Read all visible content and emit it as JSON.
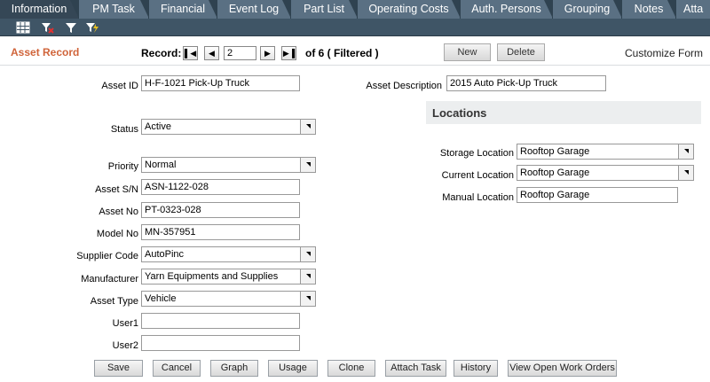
{
  "tabs": [
    {
      "label": "Information",
      "active": true
    },
    {
      "label": "PM Task"
    },
    {
      "label": "Financial"
    },
    {
      "label": "Event Log"
    },
    {
      "label": "Part List"
    },
    {
      "label": "Operating Costs"
    },
    {
      "label": "Auth. Persons"
    },
    {
      "label": "Grouping"
    },
    {
      "label": "Notes"
    },
    {
      "label": "Atta"
    }
  ],
  "toolbar": {
    "icons": [
      "grid-icon",
      "clear-filter-icon",
      "filter-icon",
      "quick-filter-icon"
    ]
  },
  "header": {
    "title": "Asset Record",
    "record_label": "Record:",
    "record_value": "2",
    "of_label": "of 6 ( Filtered )",
    "new_label": "New",
    "delete_label": "Delete",
    "customize_label": "Customize Form"
  },
  "form": {
    "asset_id": {
      "label": "Asset ID",
      "value": "H-F-1021 Pick-Up Truck"
    },
    "asset_description": {
      "label": "Asset Description",
      "value": "2015 Auto Pick-Up Truck"
    },
    "status": {
      "label": "Status",
      "value": "Active"
    },
    "priority": {
      "label": "Priority",
      "value": "Normal"
    },
    "asset_sn": {
      "label": "Asset S/N",
      "value": "ASN-1122-028"
    },
    "asset_no": {
      "label": "Asset No",
      "value": "PT-0323-028"
    },
    "model_no": {
      "label": "Model No",
      "value": "MN-357951"
    },
    "supplier_code": {
      "label": "Supplier Code",
      "value": "AutoPinc"
    },
    "manufacturer": {
      "label": "Manufacturer",
      "value": "Yarn Equipments and Supplies"
    },
    "asset_type": {
      "label": "Asset Type",
      "value": "Vehicle"
    },
    "user1": {
      "label": "User1",
      "value": ""
    },
    "user2": {
      "label": "User2",
      "value": ""
    }
  },
  "locations": {
    "title": "Locations",
    "storage": {
      "label": "Storage Location",
      "value": "Rooftop Garage"
    },
    "current": {
      "label": "Current Location",
      "value": "Rooftop Garage"
    },
    "manual": {
      "label": "Manual Location",
      "value": "Rooftop Garage"
    }
  },
  "buttons": {
    "save": "Save",
    "cancel": "Cancel",
    "graph": "Graph",
    "usage": "Usage",
    "clone": "Clone",
    "attach_task": "Attach Task",
    "history": "History",
    "view_open_work_orders": "View Open Work Orders"
  },
  "colors": {
    "tab_bar": "#53697a",
    "tab_active": "#354756",
    "accent_title": "#d0643a"
  }
}
